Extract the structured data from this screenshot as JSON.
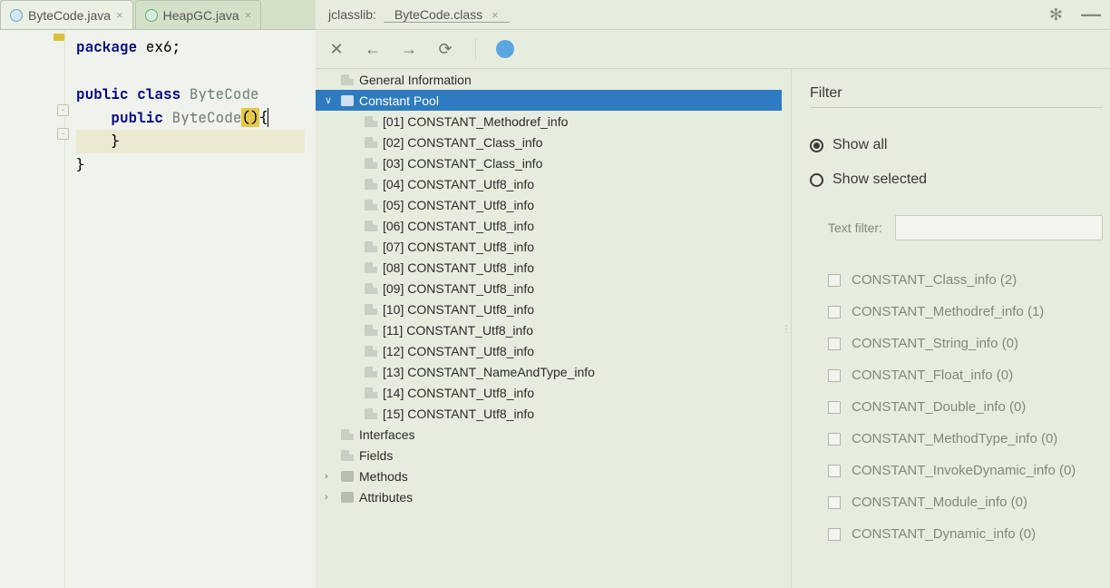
{
  "editor": {
    "tabs": [
      {
        "label": "ByteCode.java",
        "iconClass": "blue-ico"
      },
      {
        "label": "HeapGC.java",
        "iconClass": "green-ico"
      }
    ],
    "activeTab": 0,
    "code": {
      "l1a": "package",
      "l1b": " ex6;",
      "l2a": "public",
      "l2b": " ",
      "l2c": "class",
      "l2d": " ",
      "l2e": "ByteCode",
      "l3a": "    ",
      "l3b": "public",
      "l3c": " ",
      "l3d": "ByteCode",
      "l3e": "(",
      "l3f": ")",
      "l3g": "{",
      "l4": "    }",
      "l5": "}"
    }
  },
  "jclasslib": {
    "apptab": "jclasslib:",
    "filetab": "ByteCode.class",
    "tree": {
      "root1": "General Information",
      "root2": "Constant Pool",
      "cp": [
        "[01] CONSTANT_Methodref_info",
        "[02] CONSTANT_Class_info",
        "[03] CONSTANT_Class_info",
        "[04] CONSTANT_Utf8_info",
        "[05] CONSTANT_Utf8_info",
        "[06] CONSTANT_Utf8_info",
        "[07] CONSTANT_Utf8_info",
        "[08] CONSTANT_Utf8_info",
        "[09] CONSTANT_Utf8_info",
        "[10] CONSTANT_Utf8_info",
        "[11] CONSTANT_Utf8_info",
        "[12] CONSTANT_Utf8_info",
        "[13] CONSTANT_NameAndType_info",
        "[14] CONSTANT_Utf8_info",
        "[15] CONSTANT_Utf8_info"
      ],
      "root3": "Interfaces",
      "root4": "Fields",
      "root5": "Methods",
      "root6": "Attributes"
    }
  },
  "filter": {
    "title": "Filter",
    "showAll": "Show all",
    "showSel": "Show selected",
    "textFilterLabel": "Text filter:",
    "items": [
      "CONSTANT_Class_info (2)",
      "CONSTANT_Methodref_info (1)",
      "CONSTANT_String_info (0)",
      "CONSTANT_Float_info (0)",
      "CONSTANT_Double_info (0)",
      "CONSTANT_MethodType_info (0)",
      "CONSTANT_InvokeDynamic_info (0)",
      "CONSTANT_Module_info (0)",
      "CONSTANT_Dynamic_info (0)"
    ]
  }
}
